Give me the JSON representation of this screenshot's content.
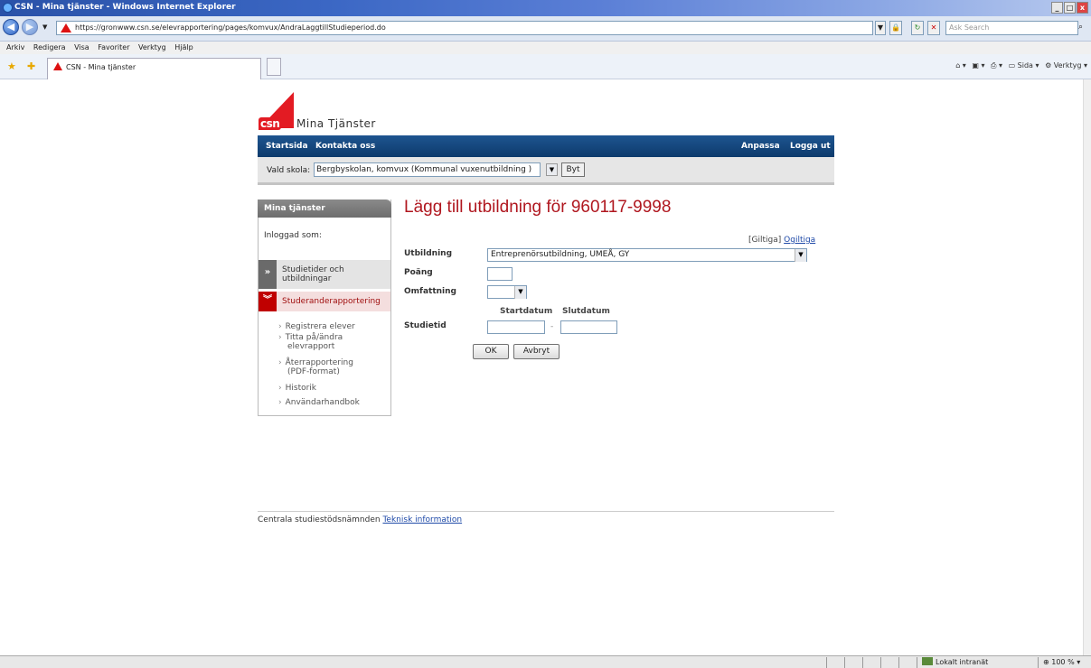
{
  "window": {
    "title": "CSN - Mina tjänster - Windows Internet Explorer"
  },
  "address": {
    "url": "https://gronwww.csn.se/elevrapportering/pages/komvux/AndraLaggtillStudieperiod.do",
    "search_placeholder": "Ask Search"
  },
  "menu": [
    "Arkiv",
    "Redigera",
    "Visa",
    "Favoriter",
    "Verktyg",
    "Hjälp"
  ],
  "tab": {
    "title": "CSN - Mina tjänster"
  },
  "commandbar": {
    "sida": "Sida",
    "verktyg": "Verktyg"
  },
  "logo": {
    "csn": "csn",
    "title": "Mina Tjänster"
  },
  "topnav": {
    "startsida": "Startsida",
    "kontakta": "Kontakta oss",
    "anpassa": "Anpassa",
    "logga_ut": "Logga ut"
  },
  "skola": {
    "label": "Vald skola:",
    "value": "Bergbyskolan, komvux (Kommunal vuxenutbildning )",
    "byt": "Byt"
  },
  "sidebar": {
    "header": "Mina tjänster",
    "login": "Inloggad som:",
    "item1": "Studietider och utbildningar",
    "item2": "Studeranderapportering",
    "sub": [
      "Registrera elever",
      "Titta på/ändra elevrapport",
      "Återrapportering (PDF-format)",
      "Historik",
      "Användarhandbok"
    ]
  },
  "form": {
    "title": "Lägg till utbildning för 960117-9998",
    "giltiga": "[Giltiga]",
    "ogiltiga": "Ogiltiga",
    "utbildning_label": "Utbildning",
    "utbildning_value": "Entreprenörsutbildning, UMEÅ, GY",
    "poang_label": "Poäng",
    "omfattning_label": "Omfattning",
    "startdatum": "Startdatum",
    "slutdatum": "Slutdatum",
    "studietid_label": "Studietid",
    "ok": "OK",
    "avbryt": "Avbryt"
  },
  "footer": {
    "text": "Centrala studiestödsnämnden",
    "link": "Teknisk information"
  },
  "status": {
    "zone": "Lokalt intranät",
    "zoom": "100 %"
  },
  "colors": {
    "brand_red": "#e31b23",
    "nav_blue": "#0d3a6c",
    "title_red": "#b0171f"
  }
}
